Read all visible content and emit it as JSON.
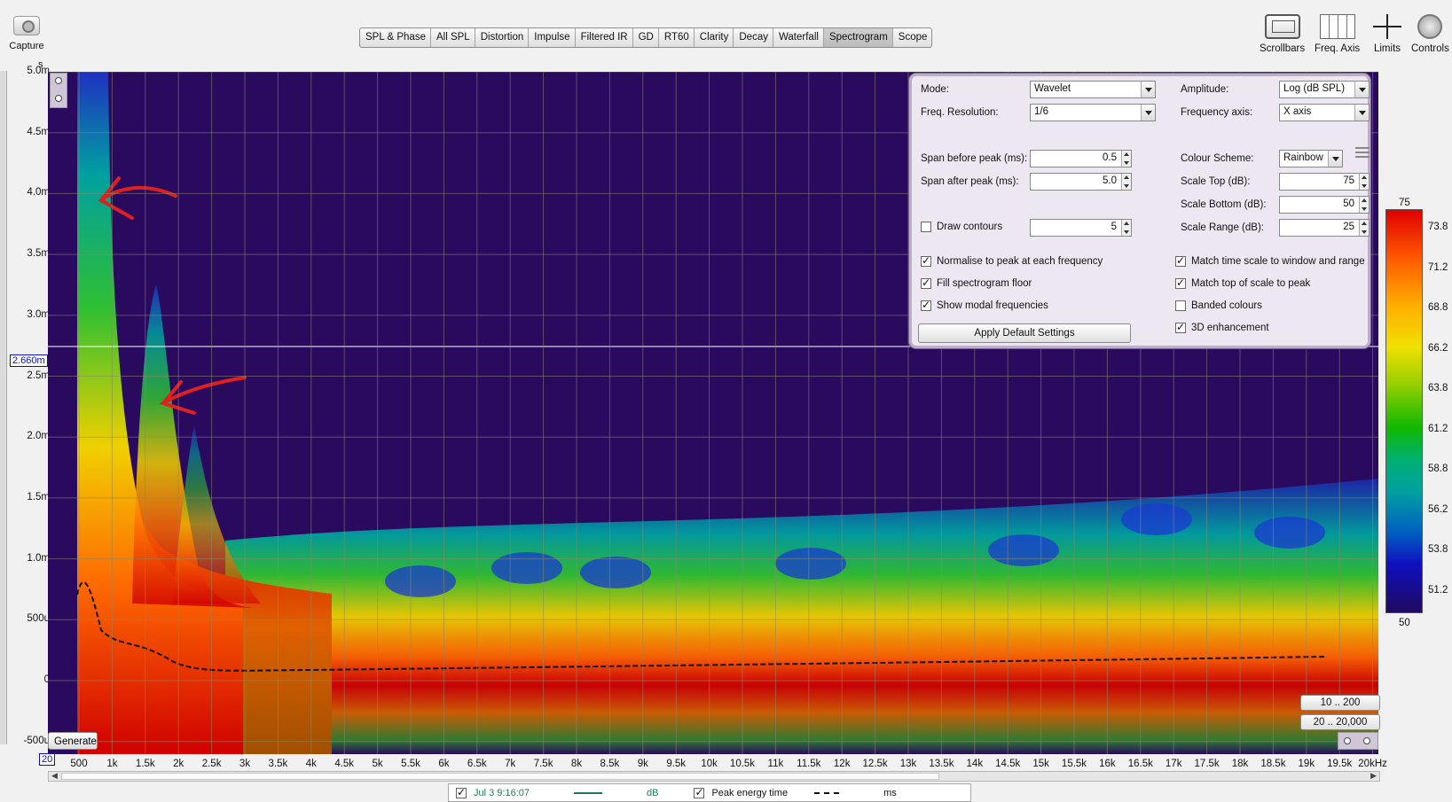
{
  "toolbar": {
    "capture_label": "Capture",
    "tabs": [
      "SPL & Phase",
      "All SPL",
      "Distortion",
      "Impulse",
      "Filtered IR",
      "GD",
      "RT60",
      "Clarity",
      "Decay",
      "Waterfall",
      "Spectrogram",
      "Scope"
    ],
    "active_tab": "Spectrogram",
    "scrollbars_label": "Scrollbars",
    "freq_axis_label": "Freq. Axis",
    "limits_label": "Limits",
    "controls_label": "Controls"
  },
  "plot": {
    "y_unit": "s",
    "y_ticks": [
      "5.0m",
      "4.5m",
      "4.0m",
      "3.5m",
      "3.0m",
      "2.5m",
      "2.0m",
      "1.5m",
      "1.0m",
      "500u",
      "0",
      "-500u"
    ],
    "cursor_value": "2.660m",
    "x_start": "20",
    "x_ticks": [
      "500",
      "1k",
      "1.5k",
      "2k",
      "2.5k",
      "3k",
      "3.5k",
      "4k",
      "4.5k",
      "5k",
      "5.5k",
      "6k",
      "6.5k",
      "7k",
      "7.5k",
      "8k",
      "8.5k",
      "9k",
      "9.5k",
      "10k",
      "10.5k",
      "11k",
      "11.5k",
      "12k",
      "12.5k",
      "13k",
      "13.5k",
      "14k",
      "14.5k",
      "15k",
      "15.5k",
      "16k",
      "16.5k",
      "17k",
      "17.5k",
      "18k",
      "18.5k",
      "19k",
      "19.5k",
      "20kHz"
    ],
    "generate_label": "Generate",
    "range_buttons": [
      "10 .. 200",
      "20 .. 20,000"
    ],
    "background_color": "#2a0a5e",
    "annotation_color": "#e02020"
  },
  "controls": {
    "mode_label": "Mode:",
    "mode_value": "Wavelet",
    "freq_res_label": "Freq. Resolution:",
    "freq_res_value": "1/6",
    "amplitude_label": "Amplitude:",
    "amplitude_value": "Log (dB SPL)",
    "freq_axis_label": "Frequency axis:",
    "freq_axis_value": "X axis",
    "span_before_label": "Span before peak (ms):",
    "span_before_value": "0.5",
    "span_after_label": "Span after peak (ms):",
    "span_after_value": "5.0",
    "colour_scheme_label": "Colour Scheme:",
    "colour_scheme_value": "Rainbow",
    "scale_top_label": "Scale Top (dB):",
    "scale_top_value": "75",
    "scale_bottom_label": "Scale Bottom (dB):",
    "scale_bottom_value": "50",
    "scale_range_label": "Scale Range (dB):",
    "scale_range_value": "25",
    "draw_contours_label": "Draw contours",
    "draw_contours_checked": false,
    "contours_value": "5",
    "normalise_label": "Normalise to peak at each frequency",
    "normalise_checked": true,
    "fill_floor_label": "Fill spectrogram floor",
    "fill_floor_checked": true,
    "show_modal_label": "Show modal frequencies",
    "show_modal_checked": true,
    "match_time_label": "Match time scale to window and range",
    "match_time_checked": true,
    "match_top_label": "Match top of scale to peak",
    "match_top_checked": true,
    "banded_label": "Banded colours",
    "banded_checked": false,
    "enhancement_label": "3D enhancement",
    "enhancement_checked": true,
    "apply_default_label": "Apply Default Settings"
  },
  "color_scale": {
    "top": "75",
    "bottom": "50",
    "ticks": [
      "73.8",
      "71.2",
      "68.8",
      "66.2",
      "63.8",
      "61.2",
      "58.8",
      "56.2",
      "53.8",
      "51.2"
    ]
  },
  "legend": {
    "measurement_name": "Jul 3 9:16:07",
    "measurement_checked": true,
    "measurement_unit": "dB",
    "measurement_color": "#1a7a5a",
    "peak_label": "Peak energy time",
    "peak_checked": true,
    "peak_unit": "ms"
  }
}
